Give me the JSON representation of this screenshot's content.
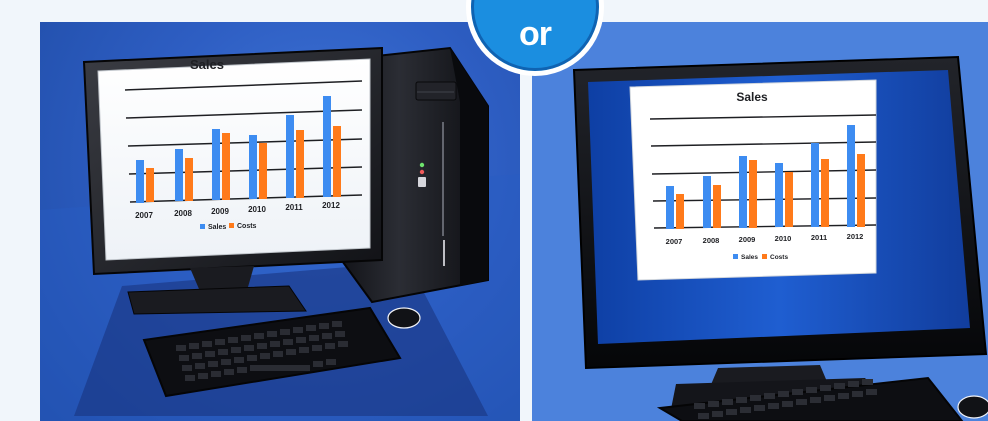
{
  "divider": {
    "label": "or"
  },
  "chart": {
    "title": "Sales",
    "years": [
      "2007",
      "2008",
      "2009",
      "2010",
      "2011",
      "2012"
    ],
    "legend": {
      "sales": "Sales",
      "costs": "Costs"
    },
    "colors": {
      "sales": "#3d8cf1",
      "costs": "#ff7a1a",
      "grid": "#222222"
    }
  },
  "scenes": {
    "left": "desktop computer with monitor, tower, keyboard and mouse",
    "right": "all-in-one computer with keyboard and mouse"
  }
}
